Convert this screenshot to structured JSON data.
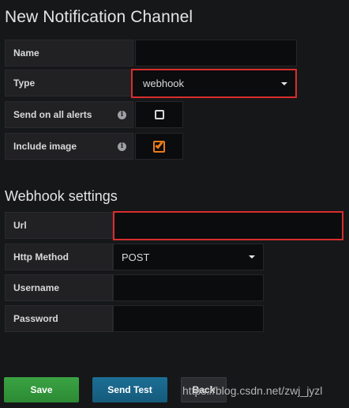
{
  "header": {
    "title": "New Notification Channel"
  },
  "form": {
    "name": {
      "label": "Name",
      "value": ""
    },
    "type": {
      "label": "Type",
      "value": "webhook"
    },
    "send_on_all_alerts": {
      "label": "Send on all alerts",
      "checked": false
    },
    "include_image": {
      "label": "Include image",
      "checked": true
    }
  },
  "webhook": {
    "title": "Webhook settings",
    "url": {
      "label": "Url",
      "value": ""
    },
    "http_method": {
      "label": "Http Method",
      "value": "POST"
    },
    "username": {
      "label": "Username",
      "value": ""
    },
    "password": {
      "label": "Password",
      "value": ""
    }
  },
  "buttons": {
    "save": "Save",
    "send_test": "Send Test",
    "back": "Back"
  },
  "watermark": "https://blog.csdn.net/zwj_jyzl",
  "colors": {
    "background": "#161719",
    "label_bg": "#212124",
    "input_bg": "#0b0c0e",
    "highlight_border": "#d92d2d",
    "checkbox_accent": "#eb7b18",
    "save_button": "#2c8a34",
    "send_test_button": "#155a7b"
  },
  "icons": {
    "info": "info-icon",
    "dropdown": "chevron-down-icon",
    "checked": "checkbox-checked-icon",
    "unchecked": "checkbox-unchecked-icon"
  }
}
